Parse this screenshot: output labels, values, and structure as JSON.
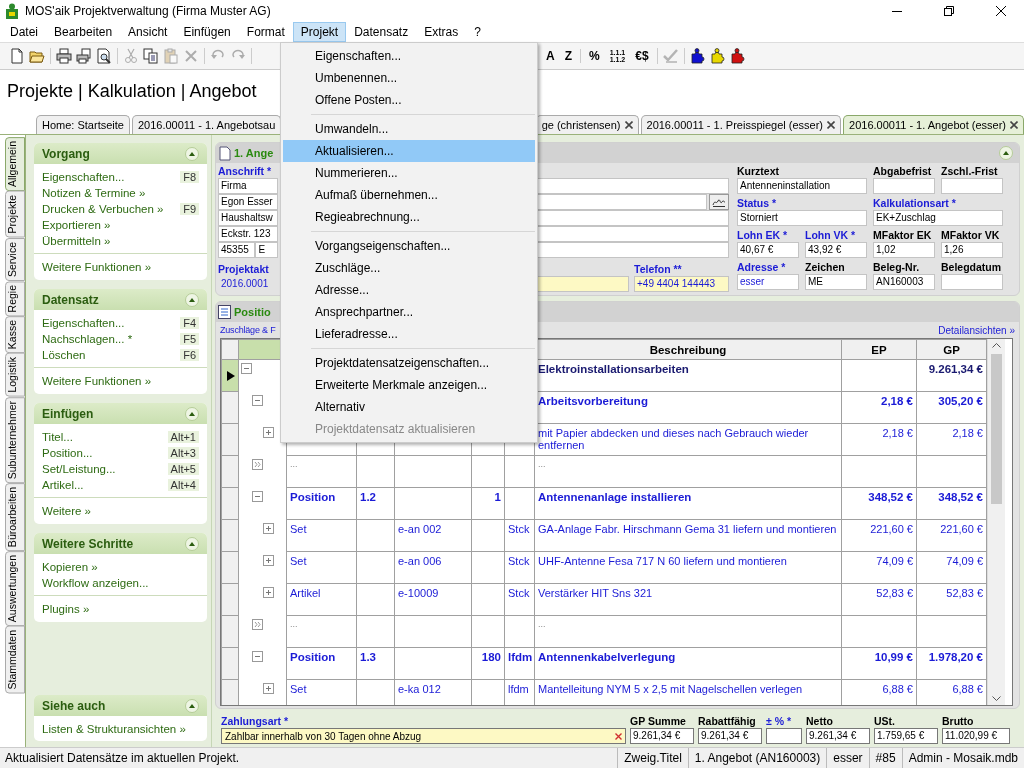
{
  "window": {
    "title": "MOS'aik Projektverwaltung (Firma Muster AG)"
  },
  "menubar": [
    {
      "label": "Datei",
      "selected": false
    },
    {
      "label": "Bearbeiten",
      "selected": false
    },
    {
      "label": "Ansicht",
      "selected": false
    },
    {
      "label": "Einfügen",
      "selected": false
    },
    {
      "label": "Format",
      "selected": false
    },
    {
      "label": "Projekt",
      "selected": true
    },
    {
      "label": "Datensatz",
      "selected": false
    },
    {
      "label": "Extras",
      "selected": false
    },
    {
      "label": "?",
      "selected": false
    }
  ],
  "toolbar": {
    "groups": [
      [
        {
          "kind": "icon",
          "disabled": false
        },
        {
          "kind": "icon",
          "disabled": false
        }
      ],
      [
        {
          "kind": "icon",
          "disabled": false
        },
        {
          "kind": "icon",
          "disabled": false
        },
        {
          "kind": "icon",
          "disabled": false
        }
      ],
      [
        {
          "kind": "icon",
          "disabled": true
        },
        {
          "kind": "icon",
          "disabled": false
        },
        {
          "kind": "icon",
          "disabled": true
        },
        {
          "kind": "icon",
          "disabled": true
        }
      ],
      [
        {
          "kind": "icon",
          "disabled": true
        },
        {
          "kind": "icon",
          "disabled": true
        }
      ],
      [
        {
          "kind": "text",
          "label": "A",
          "disabled": false
        },
        {
          "kind": "text",
          "label": "Z",
          "disabled": false
        }
      ],
      [
        {
          "kind": "text",
          "label": "%",
          "disabled": false
        },
        {
          "kind": "text",
          "label": "1.1.1\n1.1.2",
          "disabled": false
        },
        {
          "kind": "text",
          "label": "€$",
          "disabled": false
        }
      ],
      [
        {
          "kind": "icon",
          "disabled": true
        }
      ],
      [
        {
          "kind": "icon",
          "disabled": false,
          "color": "#1010d0"
        },
        {
          "kind": "icon",
          "disabled": false,
          "color": "#e8d800"
        },
        {
          "kind": "icon",
          "disabled": false,
          "color": "#d01010"
        }
      ]
    ]
  },
  "header": {
    "title": "Projekte | Kalkulation | Angebot"
  },
  "doc_tabs": [
    {
      "label": "Home: Startseite",
      "closable": false,
      "selected": false
    },
    {
      "label": "2016.00011 - 1. Angebotsau",
      "closable": false,
      "selected": false
    },
    {
      "label": "ge (christensen)",
      "closable": true,
      "selected": false
    },
    {
      "label": "2016.00011 - 1. Preisspiegel (esser)",
      "closable": true,
      "selected": false
    },
    {
      "label": "2016.00011 - 1. Angebot (esser)",
      "closable": true,
      "selected": true
    }
  ],
  "side_tabs": [
    {
      "label": "Allgemein",
      "selected": true
    },
    {
      "label": "Projekte",
      "selected": false
    },
    {
      "label": "Service",
      "selected": false
    },
    {
      "label": "Regie",
      "selected": false
    },
    {
      "label": "Kasse",
      "selected": false
    },
    {
      "label": "Logistik",
      "selected": false
    },
    {
      "label": "Subunternehmer",
      "selected": false
    },
    {
      "label": "Büroarbeiten",
      "selected": false
    },
    {
      "label": "Auswertungen",
      "selected": false
    },
    {
      "label": "Stammdaten",
      "selected": false
    }
  ],
  "sidebar": {
    "panels": [
      {
        "title": "Vorgang",
        "expanded": true,
        "items": [
          {
            "label": "Eigenschaften...",
            "shortcut": "F8"
          },
          {
            "label": "Notizen & Termine »"
          },
          {
            "label": "Drucken & Verbuchen »",
            "shortcut": "F9"
          },
          {
            "label": "Exportieren »"
          },
          {
            "label": "Übermitteln »"
          }
        ],
        "links": [
          "Weitere Funktionen »"
        ]
      },
      {
        "title": "Datensatz",
        "expanded": true,
        "items": [
          {
            "label": "Eigenschaften...",
            "shortcut": "F4"
          },
          {
            "label": "Nachschlagen... *",
            "shortcut": "F5"
          },
          {
            "label": "Löschen",
            "shortcut": "F6"
          }
        ],
        "links": [
          "Weitere Funktionen »"
        ]
      },
      {
        "title": "Einfügen",
        "expanded": true,
        "items": [
          {
            "label": "Titel...",
            "shortcut": "Alt+1"
          },
          {
            "label": "Position...",
            "shortcut": "Alt+3"
          },
          {
            "label": "Set/Leistung...",
            "shortcut": "Alt+5"
          },
          {
            "label": "Artikel...",
            "shortcut": "Alt+4"
          }
        ],
        "links": [
          "Weitere »"
        ]
      },
      {
        "title": "Weitere Schritte",
        "expanded": true,
        "items": [
          {
            "label": "Kopieren »"
          },
          {
            "label": "Workflow anzeigen..."
          }
        ],
        "links": [
          "Plugins »"
        ]
      },
      {
        "title": "Siehe auch",
        "expanded": true,
        "items": [
          {
            "label": "Listen & Strukturansichten »"
          }
        ]
      }
    ]
  },
  "form": {
    "title": "1. Ange",
    "address": {
      "label": "Anschrift *",
      "lines": [
        "Firma",
        "Egon Esser",
        "Haushaltsw",
        "Eckstr. 123"
      ],
      "zip": "45355",
      "city": "E"
    },
    "project": {
      "label": "Projektakt",
      "value": "2016.0001"
    },
    "phone": {
      "label": "Telefon **",
      "value": "+49 4404 144443"
    },
    "rows": [
      [
        {
          "label": "Kurztext",
          "required": false,
          "value": "Antenneninstallation",
          "colspan": 2
        },
        {
          "label": "Abgabefrist",
          "required": false
        },
        {
          "label": "Zschl.-Frist",
          "required": false
        }
      ],
      [
        {
          "label": "Status *",
          "required": true,
          "value": "Storniert",
          "colspan": 2
        },
        {
          "label": "Kalkulationsart *",
          "required": true,
          "value": "EK+Zuschlag",
          "colspan": 2
        }
      ],
      [
        {
          "label": "Lohn EK *",
          "required": true,
          "value": "40,67 €"
        },
        {
          "label": "Lohn VK *",
          "required": true,
          "value": "43,92 €"
        },
        {
          "label": "MFaktor EK",
          "required": false,
          "value": "1,02"
        },
        {
          "label": "MFaktor VK",
          "required": false,
          "value": "1,26"
        }
      ],
      [
        {
          "label": "Adresse *",
          "required": true,
          "value": "esser",
          "kind": "link"
        },
        {
          "label": "Zeichen",
          "required": false,
          "value": "ME"
        },
        {
          "label": "Beleg-Nr.",
          "required": false,
          "value": "AN160003"
        },
        {
          "label": "Belegdatum",
          "required": false
        }
      ]
    ]
  },
  "positions": {
    "title": "Positio",
    "link_left": "Zuschläge & F",
    "link_right": "Detailansichten »",
    "columns": [
      {
        "label": "Beschreibung"
      },
      {
        "label": "EP"
      },
      {
        "label": "GP"
      }
    ],
    "rows": [
      {
        "kind": "title",
        "selected": true,
        "expanded": true,
        "description": "Elektroinstallationsarbeiten",
        "gp": "9.261,34 €",
        "children": [
          {
            "kind": "position",
            "selected": false,
            "expanded": true,
            "description": "Arbeitsvorbereitung",
            "ep": "2,18 €",
            "gp": "305,20 €",
            "children": [
              {
                "kind": "item",
                "selected": false,
                "expanded": false,
                "description": "mit Papier abdecken und dieses nach Gebrauch wieder entfernen",
                "ep": "2,18 €",
                "gp": "2,18 €"
              }
            ]
          },
          {
            "kind": "more",
            "selected": false,
            "type": "...",
            "description": "..."
          },
          {
            "kind": "position",
            "selected": false,
            "expanded": true,
            "type": "Position",
            "nr": "1.2",
            "qty": "1",
            "description": "Antennenanlage installieren",
            "ep": "348,52 €",
            "gp": "348,52 €",
            "children": [
              {
                "kind": "item",
                "selected": false,
                "expanded": false,
                "type": "Set",
                "art_nr": "e-an 002",
                "unit": "Stck",
                "description": "GA-Anlage Fabr. Hirschmann Gema 31 liefern und montieren",
                "ep": "221,60 €",
                "gp": "221,60 €"
              },
              {
                "kind": "item",
                "selected": false,
                "expanded": false,
                "type": "Set",
                "art_nr": "e-an 006",
                "unit": "Stck",
                "description": "UHF-Antenne Fesa 717 N 60 liefern und montieren",
                "ep": "74,09 €",
                "gp": "74,09 €"
              },
              {
                "kind": "item",
                "selected": false,
                "expanded": false,
                "type": "Artikel",
                "art_nr": "e-10009",
                "unit": "Stck",
                "description": "Verstärker HIT Sns 321",
                "ep": "52,83 €",
                "gp": "52,83 €"
              }
            ]
          },
          {
            "kind": "more",
            "selected": false,
            "type": "...",
            "description": "..."
          },
          {
            "kind": "position",
            "selected": false,
            "expanded": true,
            "type": "Position",
            "nr": "1.3",
            "qty": "180",
            "unit": "lfdm",
            "description": "Antennenkabelverlegung",
            "ep": "10,99 €",
            "gp": "1.978,20 €",
            "children": [
              {
                "kind": "item",
                "selected": false,
                "expanded": false,
                "type": "Set",
                "art_nr": "e-ka 012",
                "unit": "lfdm",
                "description": "Mantelleitung NYM 5 x 2,5 mit Nagelschellen verlegen",
                "ep": "6,88 €",
                "gp": "6,88 €"
              }
            ]
          }
        ]
      }
    ]
  },
  "totals": {
    "payment": {
      "label": "Zahlungsart *",
      "value": "Zahlbar innerhalb von 30 Tagen ohne Abzug"
    },
    "fields": [
      {
        "label": "GP Summe",
        "required": false,
        "value": "9.261,34 €"
      },
      {
        "label": "Rabattfähig",
        "required": false,
        "value": "9.261,34 €"
      },
      {
        "label": "± % *",
        "required": true
      },
      {
        "label": "Netto",
        "required": false,
        "value": "9.261,34 €"
      },
      {
        "label": "USt.",
        "required": false,
        "value": "1.759,65 €"
      },
      {
        "label": "Brutto",
        "required": false,
        "value": "11.020,99 €"
      }
    ]
  },
  "project_menu": {
    "items": [
      {
        "kind": "item",
        "label": "Eigenschaften...",
        "selected": false,
        "disabled": false
      },
      {
        "kind": "item",
        "label": "Umbenennen...",
        "selected": false,
        "disabled": false
      },
      {
        "kind": "item",
        "label": "Offene Posten...",
        "selected": false,
        "disabled": false
      },
      {
        "kind": "separator"
      },
      {
        "kind": "item",
        "label": "Umwandeln...",
        "selected": false,
        "disabled": false
      },
      {
        "kind": "item",
        "label": "Aktualisieren...",
        "selected": true,
        "disabled": false
      },
      {
        "kind": "item",
        "label": "Nummerieren...",
        "selected": false,
        "disabled": false
      },
      {
        "kind": "item",
        "label": "Aufmaß übernehmen...",
        "selected": false,
        "disabled": false
      },
      {
        "kind": "item",
        "label": "Regieabrechnung...",
        "selected": false,
        "disabled": false
      },
      {
        "kind": "separator"
      },
      {
        "kind": "item",
        "label": "Vorgangseigenschaften...",
        "selected": false,
        "disabled": false
      },
      {
        "kind": "item",
        "label": "Zuschläge...",
        "selected": false,
        "disabled": false
      },
      {
        "kind": "item",
        "label": "Adresse...",
        "selected": false,
        "disabled": false
      },
      {
        "kind": "item",
        "label": "Ansprechpartner...",
        "selected": false,
        "disabled": false
      },
      {
        "kind": "item",
        "label": "Lieferadresse...",
        "selected": false,
        "disabled": false
      },
      {
        "kind": "separator"
      },
      {
        "kind": "item",
        "label": "Projektdatensatzeigenschaften...",
        "selected": false,
        "disabled": false
      },
      {
        "kind": "item",
        "label": "Erweiterte Merkmale anzeigen...",
        "selected": false,
        "disabled": false
      },
      {
        "kind": "item",
        "label": "Alternativ",
        "selected": false,
        "disabled": false
      },
      {
        "kind": "item",
        "label": "Projektdatensatz aktualisieren",
        "selected": false,
        "disabled": true
      }
    ]
  },
  "status_bar": {
    "message": "Aktualisiert Datensätze im aktuellen Projekt.",
    "cells": [
      "Zweig.Titel",
      "1. Angebot (AN160003)",
      "esser",
      "#85",
      "Admin - Mosaik.mdb"
    ]
  }
}
